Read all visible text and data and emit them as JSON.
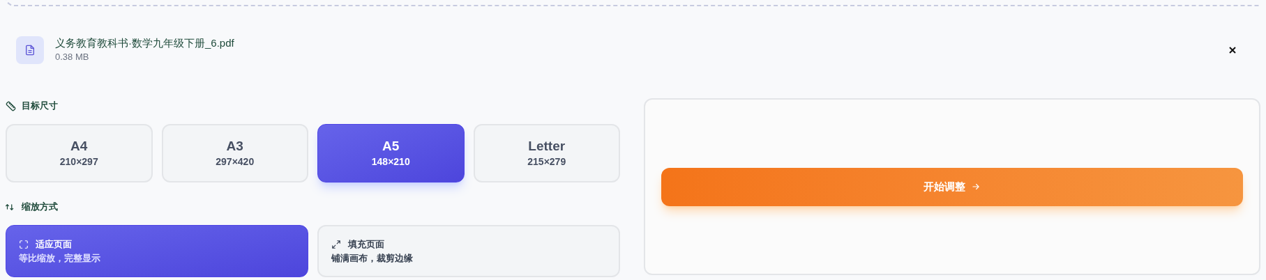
{
  "file": {
    "name": "义务教育教科书·数学九年级下册_6.pdf",
    "size": "0.38 MB"
  },
  "size_section": {
    "title": "目标尺寸"
  },
  "sizes": [
    {
      "label": "A4",
      "dimensions": "210×297",
      "selected": false
    },
    {
      "label": "A3",
      "dimensions": "297×420",
      "selected": false
    },
    {
      "label": "A5",
      "dimensions": "148×210",
      "selected": true
    },
    {
      "label": "Letter",
      "dimensions": "215×279",
      "selected": false
    }
  ],
  "scale_section": {
    "title": "缩放方式"
  },
  "modes": [
    {
      "kind": "fit",
      "title": "适应页面",
      "description": "等比缩放，完整显示",
      "selected": true
    },
    {
      "kind": "fill",
      "title": "填充页面",
      "description": "铺满画布，裁剪边缘",
      "selected": false
    }
  ],
  "start_button": {
    "label": "开始调整"
  }
}
